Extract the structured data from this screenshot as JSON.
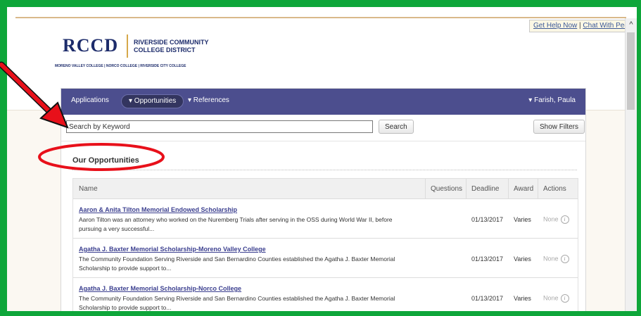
{
  "header": {
    "help_link": "Get Help Now",
    "separator": "|",
    "chat_link": "Chat With Peers"
  },
  "logo": {
    "mark": "RCCD",
    "name_line1": "RIVERSIDE COMMUNITY",
    "name_line2": "COLLEGE DISTRICT",
    "colleges": "MORENO VALLEY COLLEGE | NORCO COLLEGE | RIVERSIDE CITY COLLEGE"
  },
  "nav": {
    "applications": "Applications",
    "opportunities": "▾ Opportunities",
    "references": "▾ References",
    "user": "▾ Farish, Paula"
  },
  "search": {
    "placeholder": "Search by Keyword",
    "button": "Search",
    "filters_button": "Show Filters"
  },
  "section": {
    "title": "Our Opportunities"
  },
  "table": {
    "columns": {
      "name": "Name",
      "questions": "Questions",
      "deadline": "Deadline",
      "award": "Award",
      "actions": "Actions"
    },
    "rows": [
      {
        "title": "Aaron & Anita Tilton Memorial Endowed Scholarship",
        "description": "Aaron Tilton was an attorney who worked on the Nuremberg Trials after serving in the OSS during World War II, before pursuing a very successful...",
        "deadline": "01/13/2017",
        "award": "Varies",
        "actions": "None"
      },
      {
        "title": "Agatha J. Baxter Memorial Scholarship-Moreno Valley College",
        "description": "The Community Foundation Serving Riverside and San Bernardino Counties established the Agatha J. Baxter Memorial Scholarship to provide support to...",
        "deadline": "01/13/2017",
        "award": "Varies",
        "actions": "None"
      },
      {
        "title": "Agatha J. Baxter Memorial Scholarship-Norco College",
        "description": "The Community Foundation Serving Riverside and San Bernardino Counties established the Agatha J. Baxter Memorial Scholarship to provide support to...",
        "deadline": "01/13/2017",
        "award": "Varies",
        "actions": "None"
      }
    ]
  },
  "colors": {
    "border_green": "#0ea63a",
    "nav_purple": "#4c4e8e",
    "annotation_red": "#e8101a"
  }
}
